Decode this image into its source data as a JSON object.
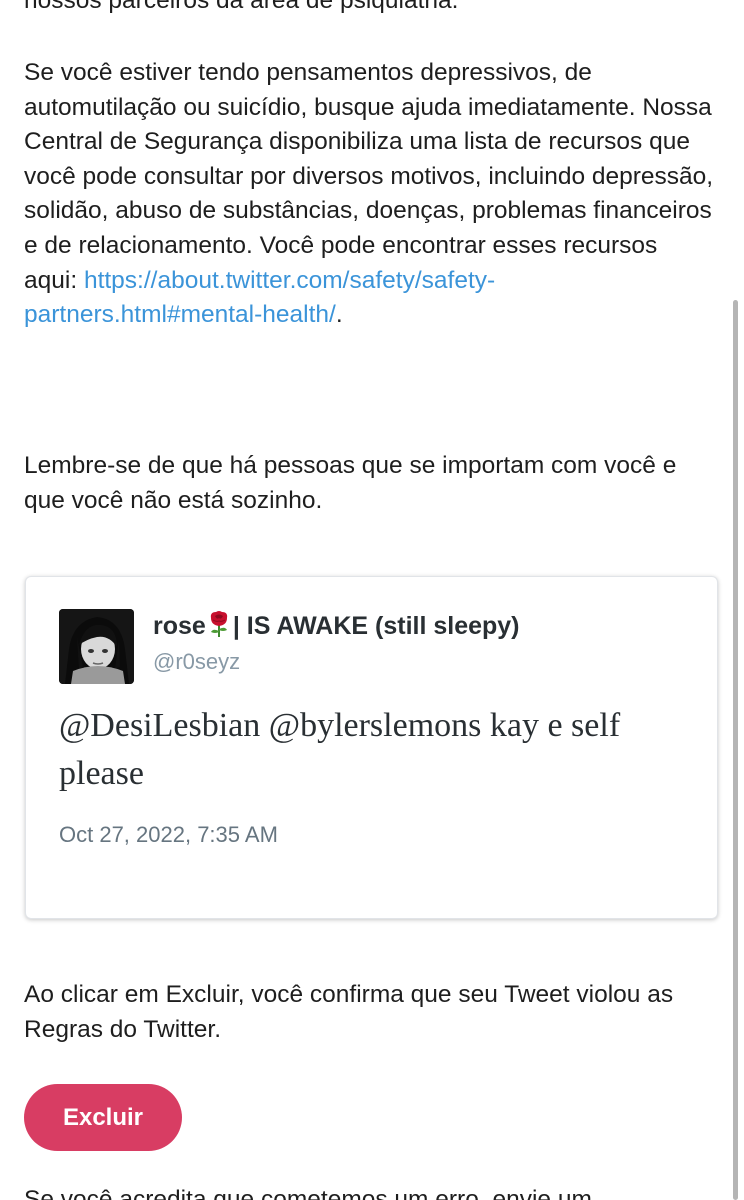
{
  "content": {
    "top_fragment": "nossos parceiros da área de psiquiatria.",
    "help_text": "Se você estiver tendo pensamentos depressivos, de automutilação ou suicídio, busque ajuda imediatamente. Nossa Central de Segurança disponibiliza uma lista de recursos que você pode consultar por diversos motivos, incluindo depressão, solidão, abuso de substâncias, doenças, problemas financeiros e de relacionamento. Você pode encontrar esses recursos aqui: ",
    "resources_link": "https://about.twitter.com/safety/safety-partners.html#mental-health/",
    "link_period": ".",
    "remember_text": "Lembre-se de que há pessoas que se importam com você e que você não está sozinho.",
    "confirm_text": "Ao clicar em Excluir, você confirma que seu Tweet violou as Regras do Twitter.",
    "bottom_fragment": "Se você acredita que cometemos um erro, envie um"
  },
  "tweet": {
    "display_name_prefix": "rose",
    "display_name_suffix": "| IS AWAKE (still sleepy)",
    "name_icon": "rose-icon",
    "handle": "@r0seyz",
    "text": "@DesiLesbian @bylerslemons kay e self please",
    "date": "Oct 27, 2022, 7:35 AM"
  },
  "actions": {
    "delete_label": "Excluir"
  },
  "colors": {
    "link": "#3b94d9",
    "delete_button": "#d83d63",
    "text": "#1e1e1e",
    "muted": "#667580"
  }
}
